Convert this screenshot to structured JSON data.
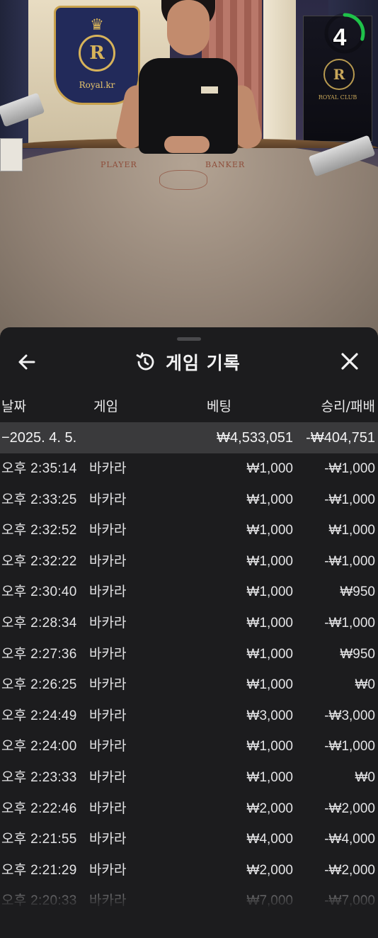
{
  "stream": {
    "crest_brand": "Royal.kr",
    "crest_letter": "R",
    "table_label_player": "PLAYER",
    "table_label_banker": "BANKER",
    "screen_brand": "ROYAL CLUB",
    "timer": {
      "value": "4",
      "progress": 0.3,
      "color": "#1fc24a"
    }
  },
  "sheet": {
    "title": "게임 기록",
    "icons": {
      "back": "back-arrow-icon",
      "history": "history-icon",
      "close": "close-icon"
    },
    "columns": {
      "date": "날짜",
      "game": "게임",
      "bet": "베팅",
      "result": "승리/패배"
    },
    "summary": {
      "date": "−2025. 4. 5.",
      "bet": "₩4,533,051",
      "result": "-₩404,751"
    },
    "rows": [
      {
        "time": "오후 2:35:14",
        "game": "바카라",
        "bet": "₩1,000",
        "result": "-₩1,000"
      },
      {
        "time": "오후 2:33:25",
        "game": "바카라",
        "bet": "₩1,000",
        "result": "-₩1,000"
      },
      {
        "time": "오후 2:32:52",
        "game": "바카라",
        "bet": "₩1,000",
        "result": "₩1,000"
      },
      {
        "time": "오후 2:32:22",
        "game": "바카라",
        "bet": "₩1,000",
        "result": "-₩1,000"
      },
      {
        "time": "오후 2:30:40",
        "game": "바카라",
        "bet": "₩1,000",
        "result": "₩950"
      },
      {
        "time": "오후 2:28:34",
        "game": "바카라",
        "bet": "₩1,000",
        "result": "-₩1,000"
      },
      {
        "time": "오후 2:27:36",
        "game": "바카라",
        "bet": "₩1,000",
        "result": "₩950"
      },
      {
        "time": "오후 2:26:25",
        "game": "바카라",
        "bet": "₩1,000",
        "result": "₩0"
      },
      {
        "time": "오후 2:24:49",
        "game": "바카라",
        "bet": "₩3,000",
        "result": "-₩3,000"
      },
      {
        "time": "오후 2:24:00",
        "game": "바카라",
        "bet": "₩1,000",
        "result": "-₩1,000"
      },
      {
        "time": "오후 2:23:33",
        "game": "바카라",
        "bet": "₩1,000",
        "result": "₩0"
      },
      {
        "time": "오후 2:22:46",
        "game": "바카라",
        "bet": "₩2,000",
        "result": "-₩2,000"
      },
      {
        "time": "오후 2:21:55",
        "game": "바카라",
        "bet": "₩4,000",
        "result": "-₩4,000"
      },
      {
        "time": "오후 2:21:29",
        "game": "바카라",
        "bet": "₩2,000",
        "result": "-₩2,000"
      },
      {
        "time": "오후 2:20:33",
        "game": "바카라",
        "bet": "₩7,000",
        "result": "-₩7,000"
      }
    ]
  }
}
